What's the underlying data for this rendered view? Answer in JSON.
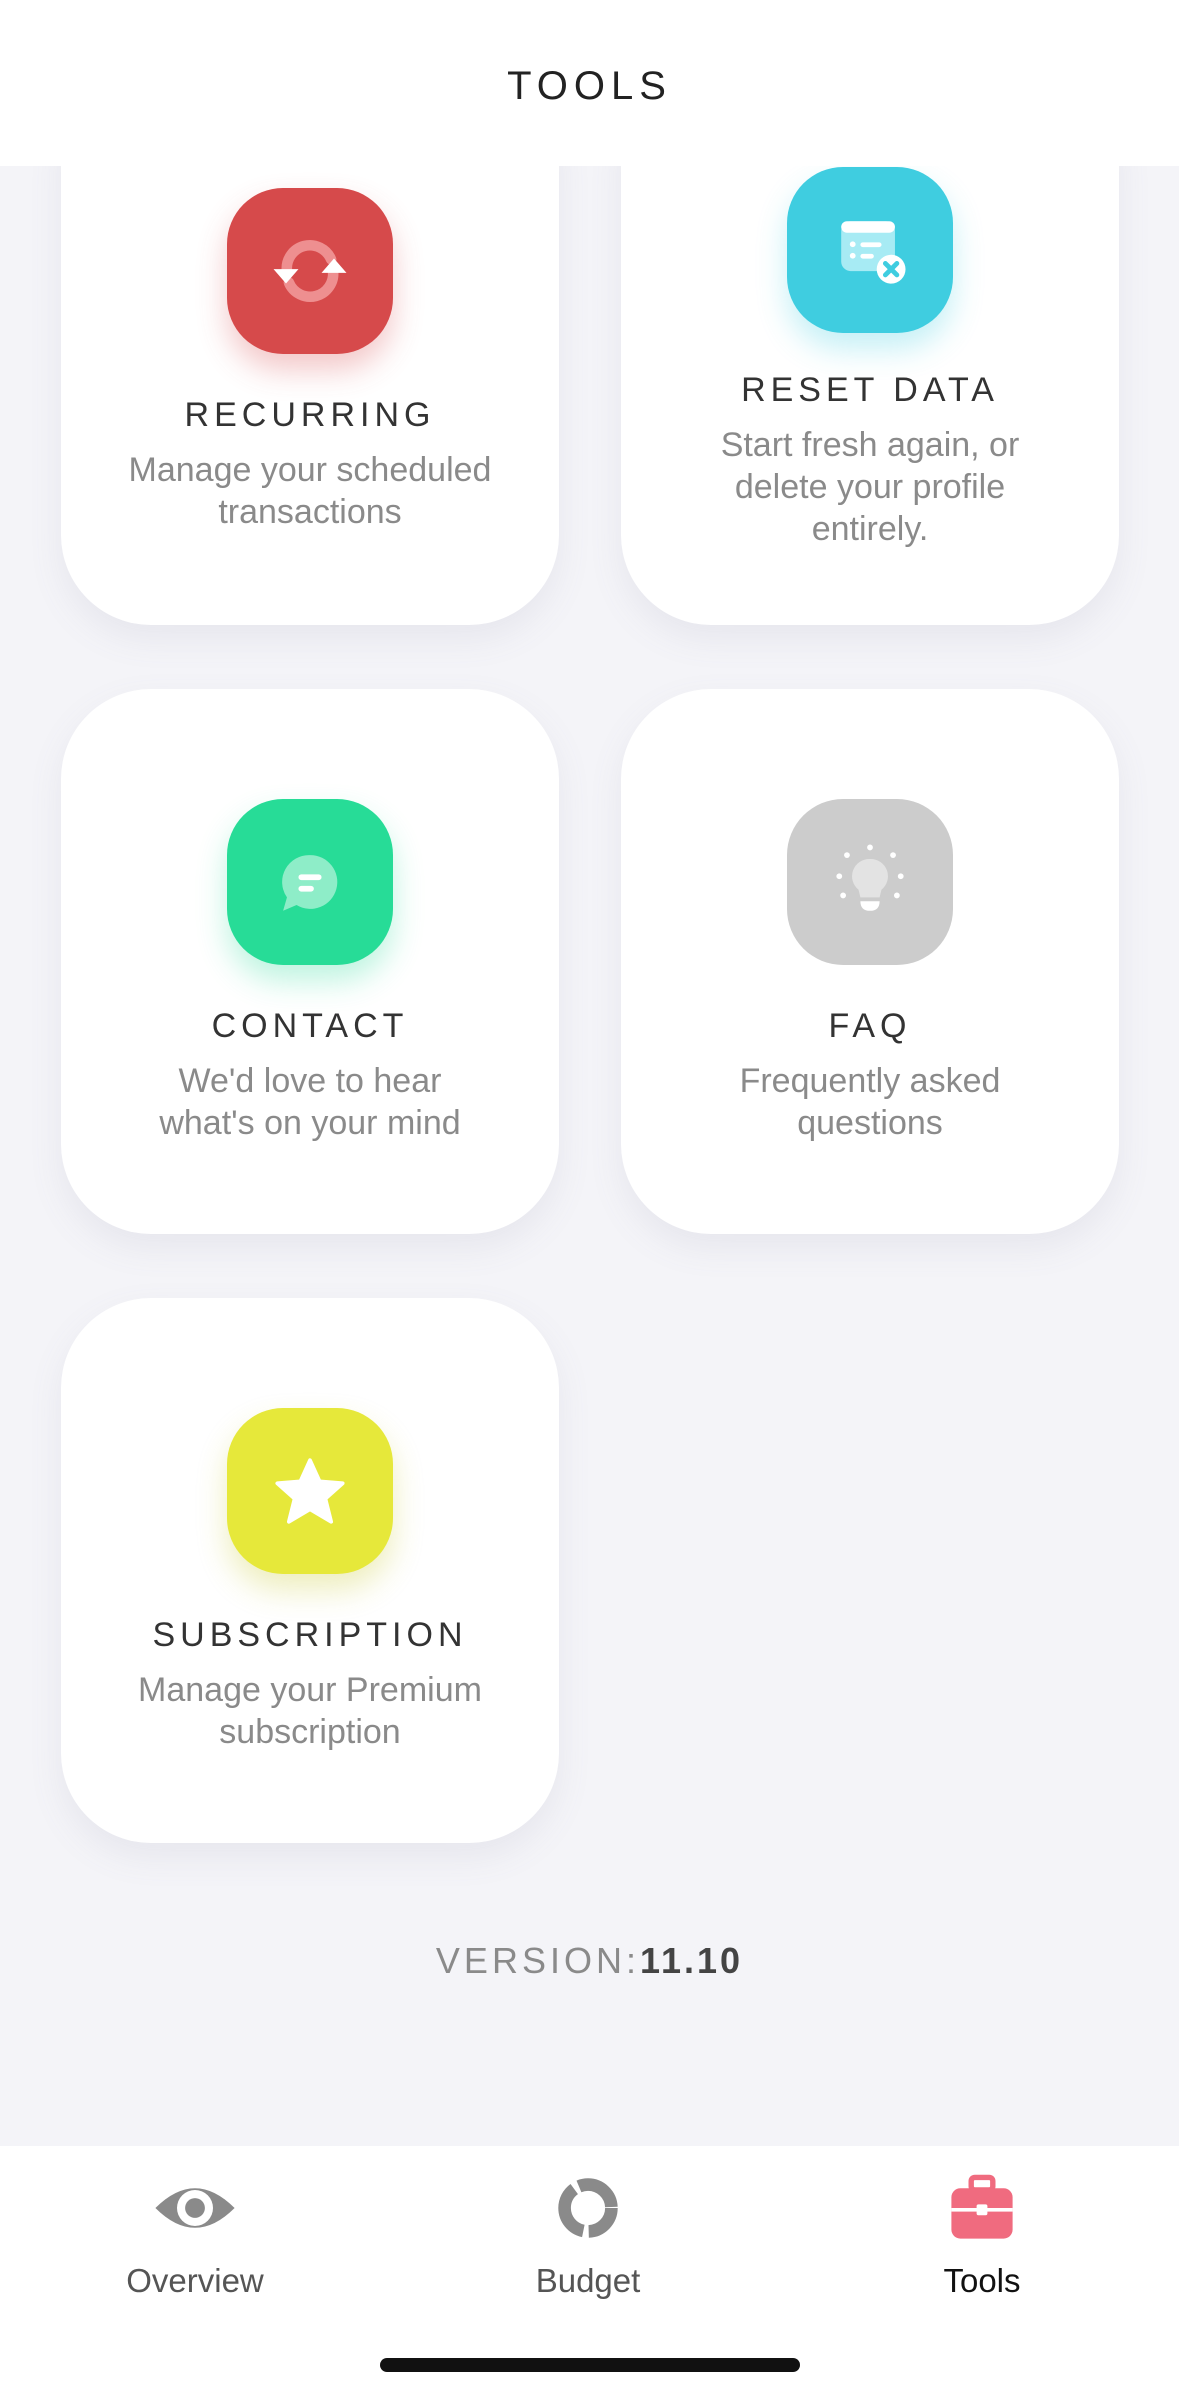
{
  "header": {
    "title": "TOOLS"
  },
  "cards": [
    {
      "id": "recurring",
      "title": "RECURRING",
      "description": "Manage your scheduled transactions",
      "color": "#d64a4b",
      "icon": "recurring-icon"
    },
    {
      "id": "reset",
      "title": "RESET DATA",
      "description": "Start fresh again, or delete your profile entirely.",
      "color": "#3fcde0",
      "icon": "reset-data-icon"
    },
    {
      "id": "contact",
      "title": "CONTACT",
      "description": "We'd love to hear what's on your mind",
      "color": "#27dc97",
      "icon": "chat-bubble-icon"
    },
    {
      "id": "faq",
      "title": "FAQ",
      "description": "Frequently asked questions",
      "color": "#cccccc",
      "icon": "lightbulb-icon"
    },
    {
      "id": "subscription",
      "title": "SUBSCRIPTION",
      "description": "Manage your Premium subscription",
      "color": "#e6e83a",
      "icon": "star-icon"
    }
  ],
  "version": {
    "label": "VERSION:",
    "number": "11.10"
  },
  "tabbar": {
    "items": [
      {
        "label": "Overview",
        "icon": "eye-icon"
      },
      {
        "label": "Budget",
        "icon": "donut-chart-icon"
      },
      {
        "label": "Tools",
        "icon": "toolbox-icon",
        "active": true
      }
    ],
    "active_color": "#f06b7f",
    "inactive_color": "#8a8a8a"
  }
}
